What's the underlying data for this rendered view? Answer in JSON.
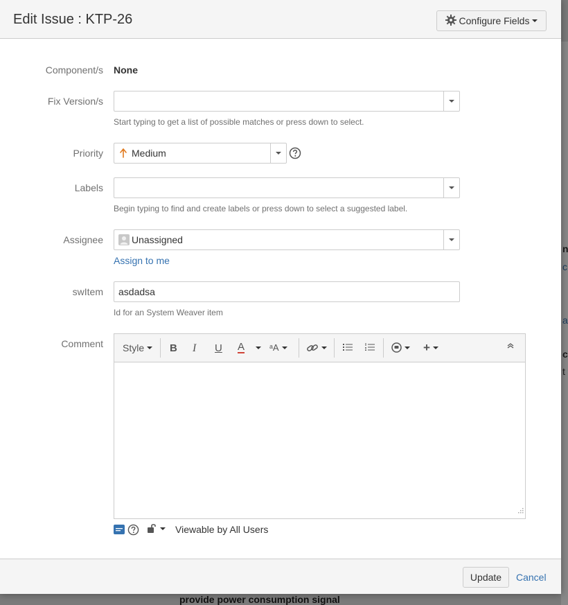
{
  "dialog": {
    "title": "Edit Issue : KTP-26",
    "configure_label": "Configure Fields"
  },
  "fields": {
    "components": {
      "label": "Component/s",
      "value": "None"
    },
    "fix_version": {
      "label": "Fix Version/s",
      "value": "",
      "hint": "Start typing to get a list of possible matches or press down to select."
    },
    "priority": {
      "label": "Priority",
      "value": "Medium"
    },
    "labels": {
      "label": "Labels",
      "value": "",
      "hint": "Begin typing to find and create labels or press down to select a suggested label."
    },
    "assignee": {
      "label": "Assignee",
      "value": "Unassigned",
      "assign_to_me": "Assign to me"
    },
    "switem": {
      "label": "swItem",
      "value": "asdadsa",
      "hint": "Id for an System Weaver item"
    },
    "comment": {
      "label": "Comment",
      "style_label": "Style",
      "visibility": "Viewable by All Users"
    }
  },
  "footer": {
    "update_label": "Update",
    "cancel_label": "Cancel"
  },
  "background": {
    "bottom_text": "provide power consumption signal",
    "fragments": [
      "nt",
      "c",
      "are",
      "cu",
      "t t"
    ]
  },
  "colors": {
    "priority_medium": "#e07a1f",
    "link": "#3572b0",
    "text_color_underline": "#d04437",
    "header_bg": "#f5f5f5"
  },
  "icons": {
    "configure": "gear-icon",
    "priority": "arrow-up-icon",
    "help": "question-circle-icon",
    "avatar": "user-avatar-icon"
  }
}
